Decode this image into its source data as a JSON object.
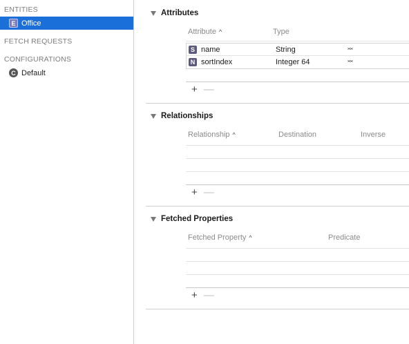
{
  "sidebar": {
    "entities_header": "ENTITIES",
    "entities": [
      {
        "badge": "E",
        "label": "Office",
        "selected": true
      }
    ],
    "fetch_requests_header": "FETCH REQUESTS",
    "configurations_header": "CONFIGURATIONS",
    "configurations": [
      {
        "badge": "C",
        "label": "Default"
      }
    ]
  },
  "attributes": {
    "title": "Attributes",
    "col_attribute": "Attribute",
    "col_type": "Type",
    "sort_indicator": "^",
    "rows": [
      {
        "badge": "S",
        "name": "name",
        "type": "String"
      },
      {
        "badge": "N",
        "name": "sortIndex",
        "type": "Integer 64"
      }
    ],
    "add_label": "+",
    "remove_label": "—"
  },
  "relationships": {
    "title": "Relationships",
    "col_relationship": "Relationship",
    "col_destination": "Destination",
    "col_inverse": "Inverse",
    "sort_indicator": "^",
    "add_label": "+",
    "remove_label": "—"
  },
  "fetched_properties": {
    "title": "Fetched Properties",
    "col_fetched_property": "Fetched Property",
    "col_predicate": "Predicate",
    "sort_indicator": "^",
    "add_label": "+",
    "remove_label": "—"
  },
  "colors": {
    "selection": "#1a6fd9"
  },
  "icons": {
    "disclosure": "disclosure-triangle-icon",
    "stepper": "up-down-chevron-icon"
  }
}
